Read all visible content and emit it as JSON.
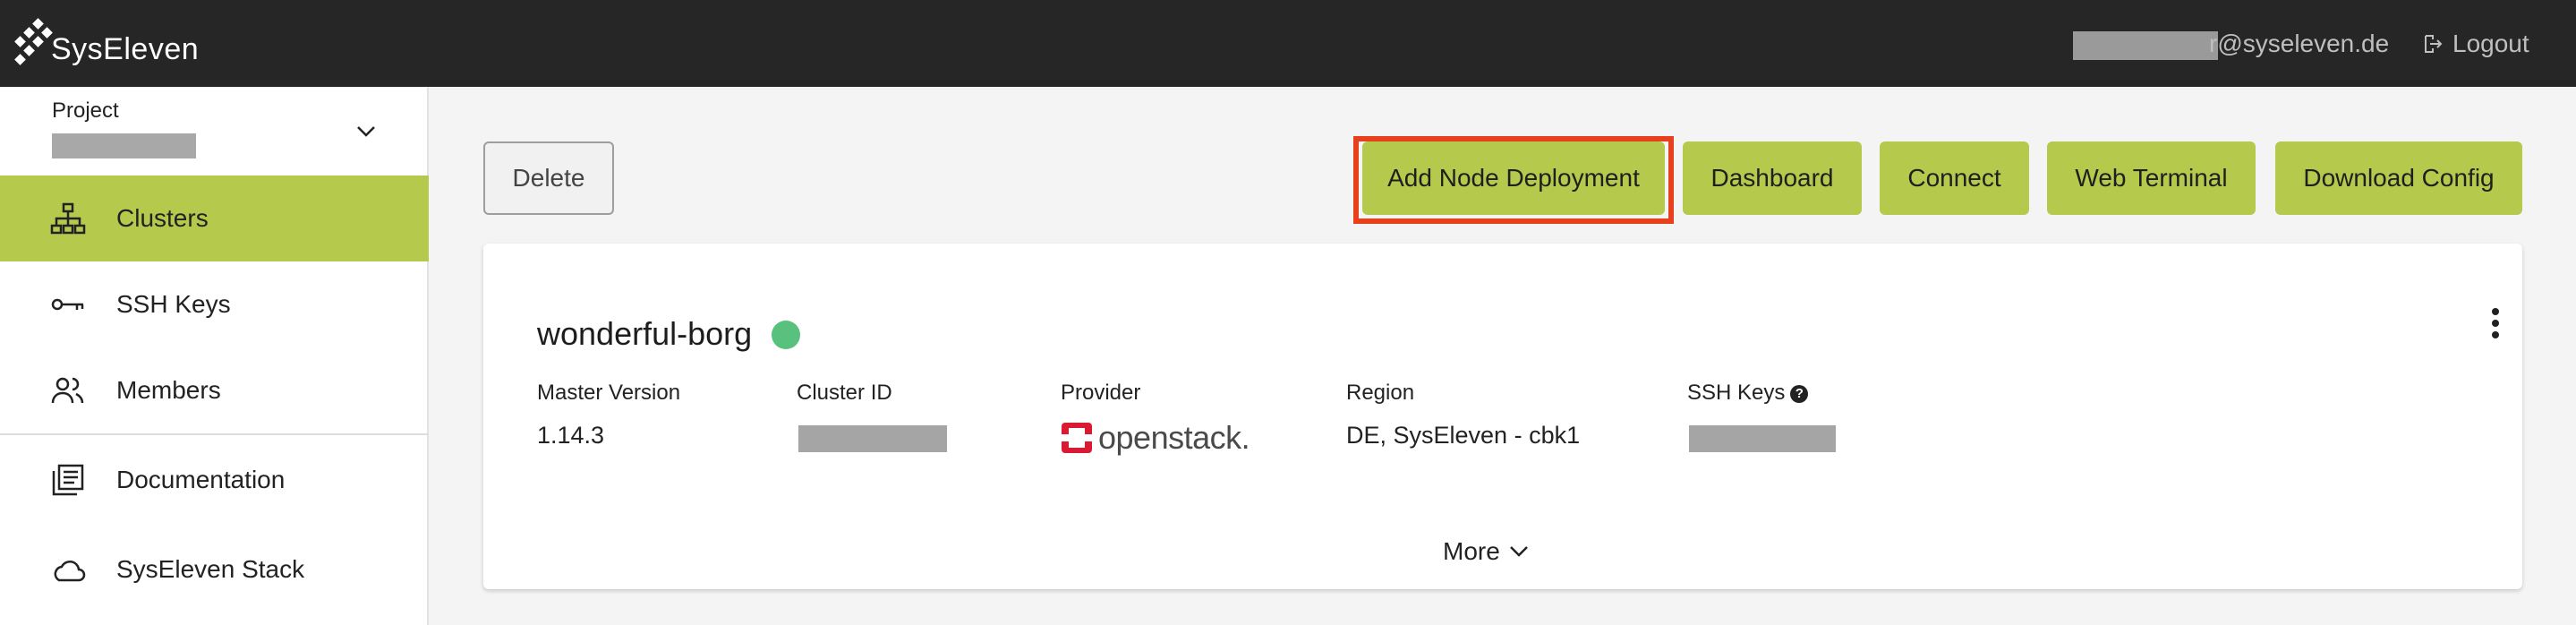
{
  "topbar": {
    "brand": "SysEleven",
    "user_email_suffix": "r@syseleven.de",
    "logout_label": "Logout"
  },
  "sidebar": {
    "project_label": "Project",
    "items": [
      {
        "label": "Clusters",
        "icon": "sitemap-icon",
        "active": true
      },
      {
        "label": "SSH Keys",
        "icon": "key-icon",
        "active": false
      },
      {
        "label": "Members",
        "icon": "people-icon",
        "active": false
      },
      {
        "label": "Documentation",
        "icon": "book-icon",
        "active": false
      },
      {
        "label": "SysEleven Stack",
        "icon": "cloud-icon",
        "active": false
      }
    ]
  },
  "toolbar": {
    "delete_label": "Delete",
    "add_node_label": "Add Node Deployment",
    "dashboard_label": "Dashboard",
    "connect_label": "Connect",
    "web_terminal_label": "Web Terminal",
    "download_config_label": "Download Config"
  },
  "cluster": {
    "name": "wonderful-borg",
    "status_color": "#58c17d",
    "headers": {
      "master_version": "Master Version",
      "cluster_id": "Cluster ID",
      "provider": "Provider",
      "region": "Region",
      "ssh_keys": "SSH Keys"
    },
    "master_version": "1.14.3",
    "provider_name": "openstack.",
    "region": "DE, SysEleven - cbk1",
    "more_label": "More"
  },
  "colors": {
    "accent": "#b5c94d",
    "highlight": "#e8401c",
    "topbar": "#262626"
  }
}
